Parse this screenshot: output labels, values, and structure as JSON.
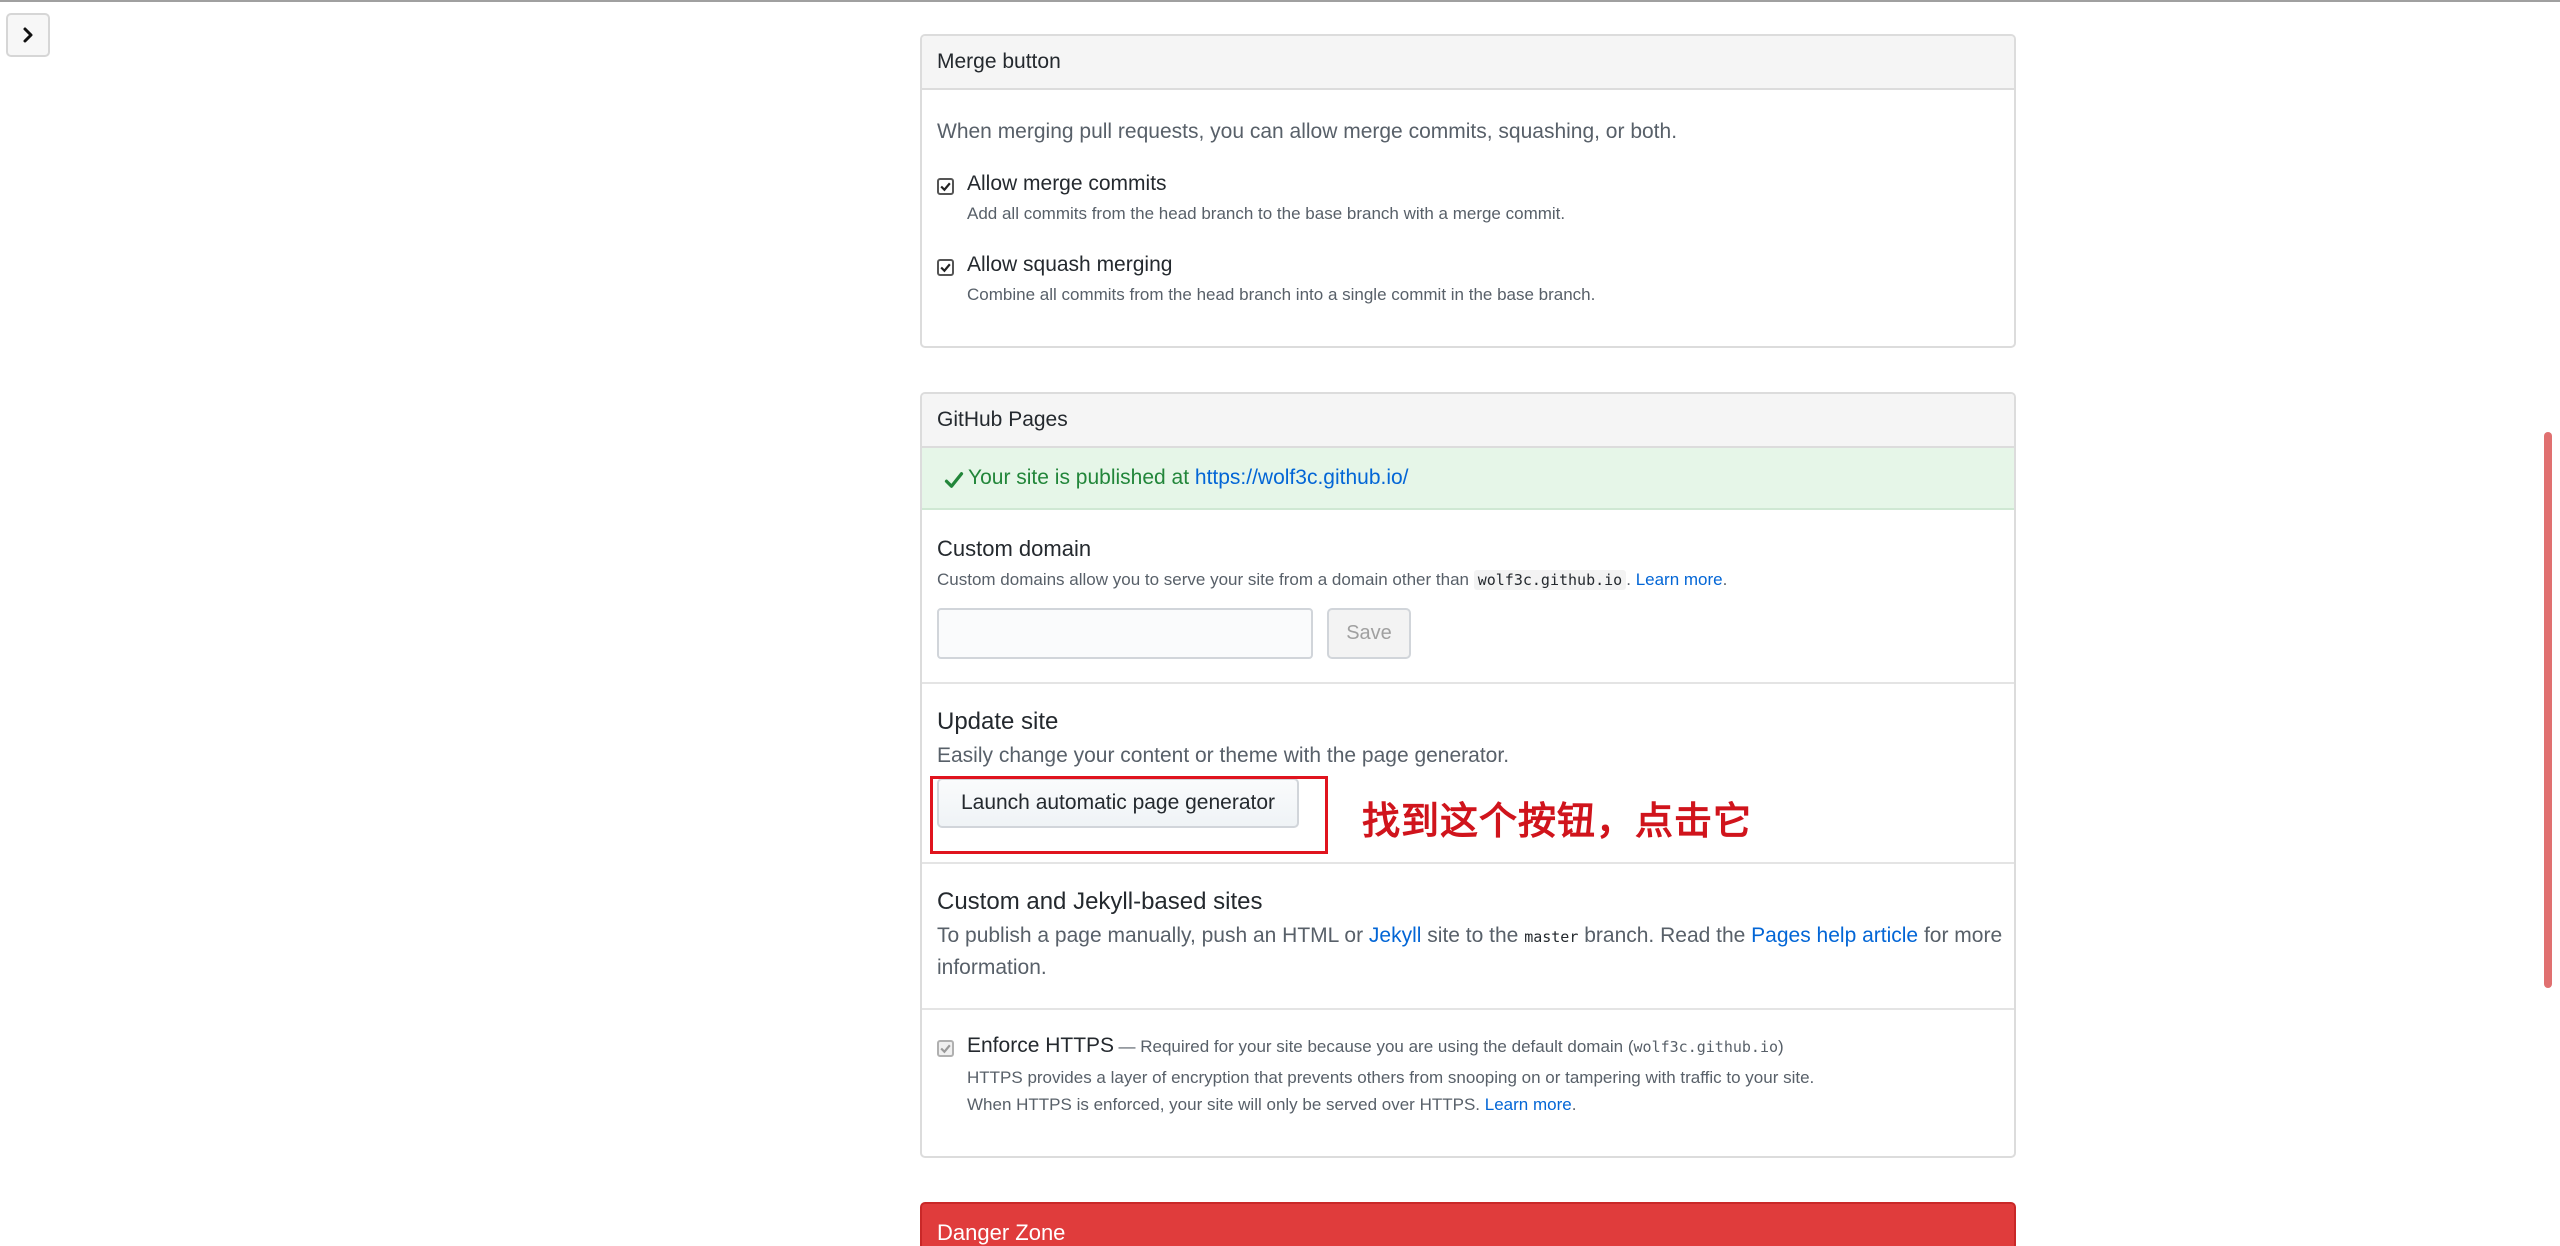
{
  "sidebar_toggle": {
    "icon": "chevron-right-icon"
  },
  "merge_button": {
    "header": "Merge button",
    "description": "When merging pull requests, you can allow merge commits, squashing, or both.",
    "options": [
      {
        "title": "Allow merge commits",
        "note": "Add all commits from the head branch to the base branch with a merge commit.",
        "checked": true
      },
      {
        "title": "Allow squash merging",
        "note": "Combine all commits from the head branch into a single commit in the base branch.",
        "checked": true
      }
    ]
  },
  "github_pages": {
    "header": "GitHub Pages",
    "published": {
      "text": "Your site is published at",
      "url": "https://wolf3c.github.io/"
    },
    "custom_domain": {
      "title": "Custom domain",
      "description": "Custom domains allow you to serve your site from a domain other than",
      "code": "wolf3c.github.io",
      "period": ".",
      "learn_more": "Learn more",
      "learn_more_suffix": ".",
      "input_value": "",
      "save_label": "Save"
    },
    "update_site": {
      "title": "Update site",
      "description": "Easily change your content or theme with the page generator.",
      "button_label": "Launch automatic page generator"
    },
    "jekyll": {
      "title": "Custom and Jekyll-based sites",
      "text_before_jekyll": "To publish a page manually, push an HTML or",
      "jekyll_link": "Jekyll",
      "text_before_code": "site to the",
      "code": "master",
      "text_before_help": "branch. Read the",
      "help_link": "Pages help article",
      "text_after_help": "for more",
      "text_line2": "information."
    },
    "https": {
      "title": "Enforce HTTPS",
      "title_note_before": "— Required for your site because you are using the default domain (",
      "title_note_code": "wolf3c.github.io",
      "title_note_after": ")",
      "line1": "HTTPS provides a layer of encryption that prevents others from snooping on or tampering with traffic to your site.",
      "line2": "When HTTPS is enforced, your site will only be served over HTTPS.",
      "learn_more": "Learn more",
      "learn_more_suffix": ".",
      "checked": true,
      "disabled": true
    }
  },
  "annotation": {
    "text": "找到这个按钮，点击它",
    "color": "#e0141e"
  },
  "danger_zone": {
    "header": "Danger Zone",
    "color": "#e03c3c"
  },
  "colors": {
    "link": "#0366d6",
    "success_bg": "#e6f6e8",
    "success_text": "#22863a"
  }
}
